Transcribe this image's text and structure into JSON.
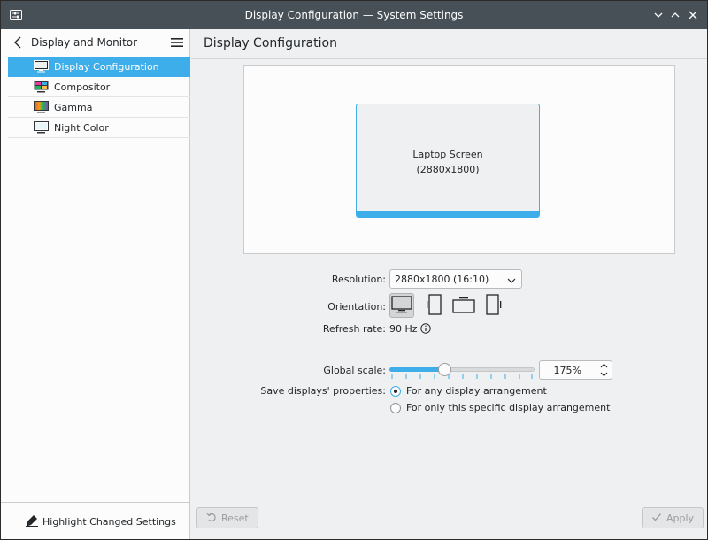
{
  "window": {
    "title": "Display Configuration — System Settings",
    "app_icon": "system-settings-icon",
    "controls": [
      "minimize-icon",
      "maximize-icon",
      "close-icon"
    ]
  },
  "sidebar": {
    "header_title": "Display and Monitor",
    "back_icon": "chevron-left-icon",
    "menu_icon": "hamburger-menu-icon",
    "items": [
      {
        "label": "Display Configuration",
        "icon": "monitor-icon",
        "active": true
      },
      {
        "label": "Compositor",
        "icon": "compositor-icon",
        "active": false
      },
      {
        "label": "Gamma",
        "icon": "gamma-icon",
        "active": false
      },
      {
        "label": "Night Color",
        "icon": "night-color-icon",
        "active": false
      }
    ],
    "highlight_button": "Highlight Changed Settings"
  },
  "main": {
    "title": "Display Configuration",
    "screen": {
      "name": "Laptop Screen",
      "resolution": "(2880x1800)"
    },
    "resolution_label": "Resolution:",
    "resolution_value": "2880x1800 (16:10)",
    "orientation_label": "Orientation:",
    "orientation_options": [
      "landscape-icon",
      "portrait-left-icon",
      "landscape-inverted-icon",
      "portrait-right-icon"
    ],
    "orientation_selected": 0,
    "refresh_rate_label": "Refresh rate:",
    "refresh_rate_value": "90 Hz",
    "global_scale_label": "Global scale:",
    "global_scale_value": "175%",
    "global_scale_slider_fraction": 0.38,
    "save_label": "Save displays' properties:",
    "save_options": [
      {
        "label": "For any display arrangement",
        "checked": true
      },
      {
        "label": "For only this specific display arrangement",
        "checked": false
      }
    ]
  },
  "footer": {
    "reset_label": "Reset",
    "apply_label": "Apply"
  },
  "colors": {
    "accent": "#3daee9",
    "titlebar": "#475057",
    "background": "#eff0f1",
    "surface": "#fcfcfc"
  }
}
